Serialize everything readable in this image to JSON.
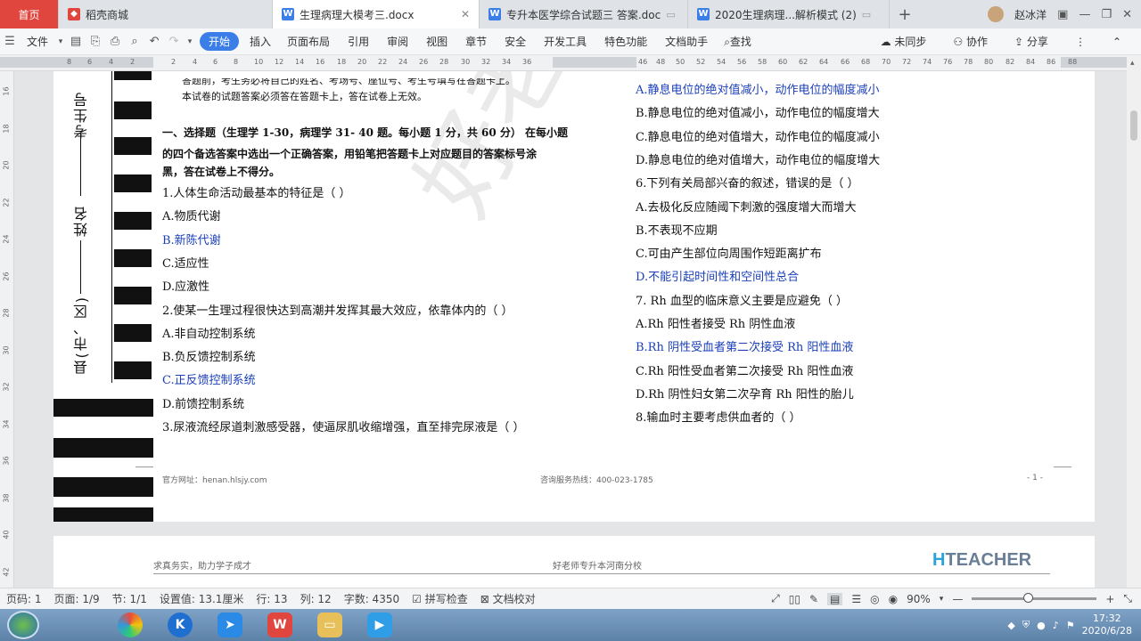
{
  "tabs": [
    {
      "label": "首页",
      "icon": "home-tab"
    },
    {
      "label": "稻壳商城",
      "icon": "docer-icon"
    },
    {
      "label": "生理病理大模考三.docx",
      "icon": "word-doc-icon",
      "active": true
    },
    {
      "label": "专升本医学综合试题三  答案.doc",
      "icon": "word-doc-icon"
    },
    {
      "label": "2020生理病理...解析模式 (2)",
      "icon": "word-doc-icon"
    }
  ],
  "user": {
    "name": "赵冰洋"
  },
  "menu": {
    "file": "文件",
    "items": [
      "开始",
      "插入",
      "页面布局",
      "引用",
      "审阅",
      "视图",
      "章节",
      "安全",
      "开发工具",
      "特色功能",
      "文档助手"
    ],
    "search": "查找",
    "sync": "未同步",
    "collab": "协作",
    "share": "分享"
  },
  "ruler_numbers": [
    "8",
    "6",
    "4",
    "2",
    "2",
    "4",
    "6",
    "8",
    "10",
    "12",
    "14",
    "16",
    "18",
    "20",
    "22",
    "24",
    "26",
    "28",
    "30",
    "32",
    "34",
    "36",
    "46",
    "48",
    "50",
    "52",
    "54",
    "56",
    "58",
    "60",
    "62",
    "64",
    "66",
    "68",
    "70",
    "72",
    "74",
    "76",
    "78",
    "80",
    "82",
    "84",
    "86",
    "88"
  ],
  "vruler_numbers": [
    "16",
    "18",
    "20",
    "22",
    "24",
    "26",
    "28",
    "30",
    "32",
    "34",
    "36",
    "38",
    "40",
    "42"
  ],
  "doc": {
    "side_labels": [
      "考生号",
      "姓名",
      "县(市、区)"
    ],
    "intro_line1": "答题前，考生务必将自己的姓名、考场号、座位号、考生号填写在答题卡上。",
    "intro_line2": "本试卷的试题答案必须答在答题卡上，答在试卷上无效。",
    "section_title_1": "一、选择题（生理学 1-30，病理学 31- 40 题。每小题 1 分，共 60 分）  在每小题",
    "section_title_2": "的四个备选答案中选出一个正确答案，用铅笔把答题卡上对应题目的答案标号涂",
    "section_title_3": "黑，答在试卷上不得分。",
    "left_lines": [
      {
        "text": "1.人体生命活动最基本的特征是（     ）",
        "answer": false
      },
      {
        "text": "A.物质代谢",
        "answer": false
      },
      {
        "text": "B.新陈代谢",
        "answer": true
      },
      {
        "text": "C.适应性",
        "answer": false
      },
      {
        "text": "D.应激性",
        "answer": false
      },
      {
        "text": "2.使某一生理过程很快达到高潮并发挥其最大效应，依靠体内的（     ）",
        "answer": false
      },
      {
        "text": "A.非自动控制系统",
        "answer": false
      },
      {
        "text": "B.负反馈控制系统",
        "answer": false
      },
      {
        "text": "C.正反馈控制系统",
        "answer": true
      },
      {
        "text": "D.前馈控制系统",
        "answer": false
      },
      {
        "text": "3.尿液流经尿道刺激感受器，使逼尿肌收缩增强，直至排完尿液是（     ）",
        "answer": false
      }
    ],
    "right_lines": [
      {
        "text": "A.静息电位的绝对值减小，动作电位的幅度减小",
        "answer": true
      },
      {
        "text": "B.静息电位的绝对值减小，动作电位的幅度增大",
        "answer": false
      },
      {
        "text": "C.静息电位的绝对值增大，动作电位的幅度减小",
        "answer": false
      },
      {
        "text": "D.静息电位的绝对值增大，动作电位的幅度增大",
        "answer": false
      },
      {
        "text": "6.下列有关局部兴奋的叙述，错误的是（     ）",
        "answer": false
      },
      {
        "text": "A.去极化反应随阈下刺激的强度增大而增大",
        "answer": false
      },
      {
        "text": "B.不表现不应期",
        "answer": false
      },
      {
        "text": "C.可由产生部位向周围作短距离扩布",
        "answer": false
      },
      {
        "text": "D.不能引起时间性和空间性总合",
        "answer": true
      },
      {
        "text": "7.  Rh 血型的临床意义主要是应避免（     ）",
        "answer": false
      },
      {
        "text": "A.Rh 阳性者接受 Rh 阴性血液",
        "answer": false
      },
      {
        "text": "B.Rh 阴性受血者第二次接受 Rh 阳性血液",
        "answer": true
      },
      {
        "text": "C.Rh 阳性受血者第二次接受 Rh 阳性血液",
        "answer": false
      },
      {
        "text": "D.Rh 阴性妇女第二次孕育 Rh 阳性的胎儿",
        "answer": false
      },
      {
        "text": "8.输血时主要考虑供血者的（     ）",
        "answer": false
      }
    ],
    "footer_site": "官方网址：henan.hlsjy.com",
    "footer_phone": "咨询服务热线：400-023-1785",
    "footer_page": "- 1 -",
    "page2_header_left": "求真务实，助力学子成才",
    "page2_header_mid": "好老师专升本河南分校",
    "page2_logo": "TEACHER",
    "watermark": "好老师"
  },
  "status": {
    "page_no": "页码: 1",
    "pages": "页面: 1/9",
    "section": "节: 1/1",
    "setting": "设置值: 13.1厘米",
    "row": "行: 13",
    "col": "列: 12",
    "words": "字数: 4350",
    "spellcheck": "拼写检查",
    "proofread": "文档校对",
    "zoom": "90%",
    "zoom_level": 0.45
  },
  "taskbar": {
    "time": "17:32",
    "date": "2020/6/28"
  }
}
